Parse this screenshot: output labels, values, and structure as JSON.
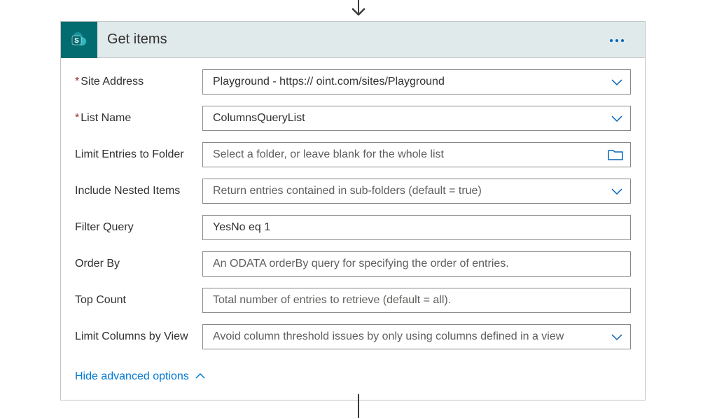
{
  "header": {
    "title": "Get items"
  },
  "fields": {
    "siteAddress": {
      "label": "Site Address",
      "value": "Playground - https://                                   oint.com/sites/Playground",
      "required": true
    },
    "listName": {
      "label": "List Name",
      "value": "ColumnsQueryList",
      "required": true
    },
    "limitFolder": {
      "label": "Limit Entries to Folder",
      "placeholder": "Select a folder, or leave blank for the whole list"
    },
    "includeNested": {
      "label": "Include Nested Items",
      "placeholder": "Return entries contained in sub-folders (default = true)"
    },
    "filterQuery": {
      "label": "Filter Query",
      "value": "YesNo eq 1"
    },
    "orderBy": {
      "label": "Order By",
      "placeholder": "An ODATA orderBy query for specifying the order of entries."
    },
    "topCount": {
      "label": "Top Count",
      "placeholder": "Total number of entries to retrieve (default = all)."
    },
    "limitColumns": {
      "label": "Limit Columns by View",
      "placeholder": "Avoid column threshold issues by only using columns defined in a view"
    }
  },
  "advanced": {
    "toggleLabel": "Hide advanced options"
  }
}
